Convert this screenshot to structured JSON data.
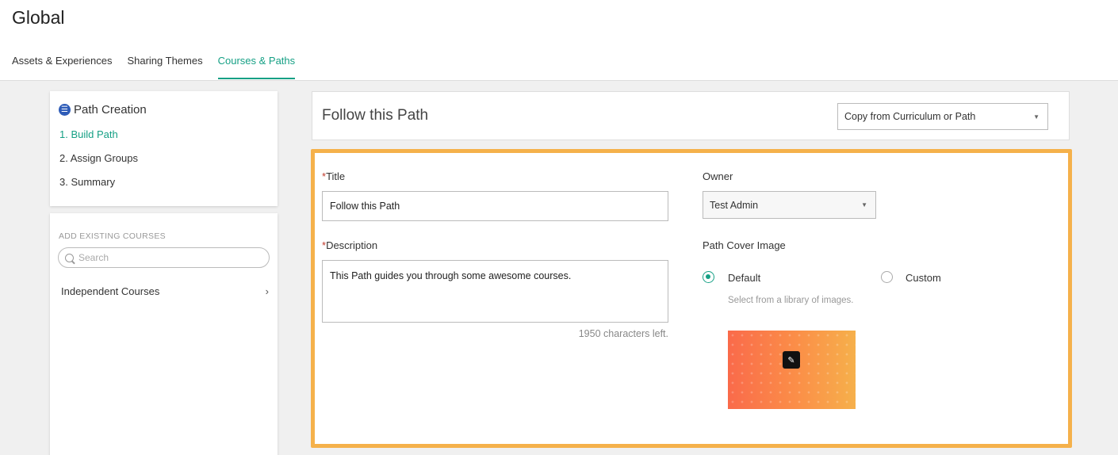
{
  "page": {
    "title": "Global"
  },
  "tabs": [
    {
      "label": "Assets & Experiences"
    },
    {
      "label": "Sharing Themes"
    },
    {
      "label": "Courses & Paths"
    }
  ],
  "sidebar": {
    "steps_title": "Path Creation",
    "steps": [
      {
        "label": "1. Build Path"
      },
      {
        "label": "2. Assign Groups"
      },
      {
        "label": "3. Summary"
      }
    ],
    "add_existing_label": "ADD EXISTING COURSES",
    "search_placeholder": "Search",
    "independent_courses_label": "Independent Courses"
  },
  "header": {
    "title": "Follow this Path",
    "copy_select_value": "Copy from Curriculum or Path"
  },
  "form": {
    "title_label": "Title",
    "title_value": "Follow this Path",
    "description_label": "Description",
    "description_value": "This Path guides you through some awesome courses.",
    "chars_left": "1950 characters left.",
    "owner_label": "Owner",
    "owner_value": "Test Admin",
    "cover_label": "Path Cover Image",
    "cover_default_label": "Default",
    "cover_custom_label": "Custom",
    "cover_hint": "Select from a library of images."
  },
  "colors": {
    "accent": "#16a085",
    "highlight_border": "#f5b14b",
    "required": "#c0392b"
  },
  "icons": {
    "path_icon": "path-icon",
    "search": "search-icon",
    "chevron": "chevron-right-icon",
    "caret": "caret-down-icon",
    "edit": "pencil-icon"
  }
}
